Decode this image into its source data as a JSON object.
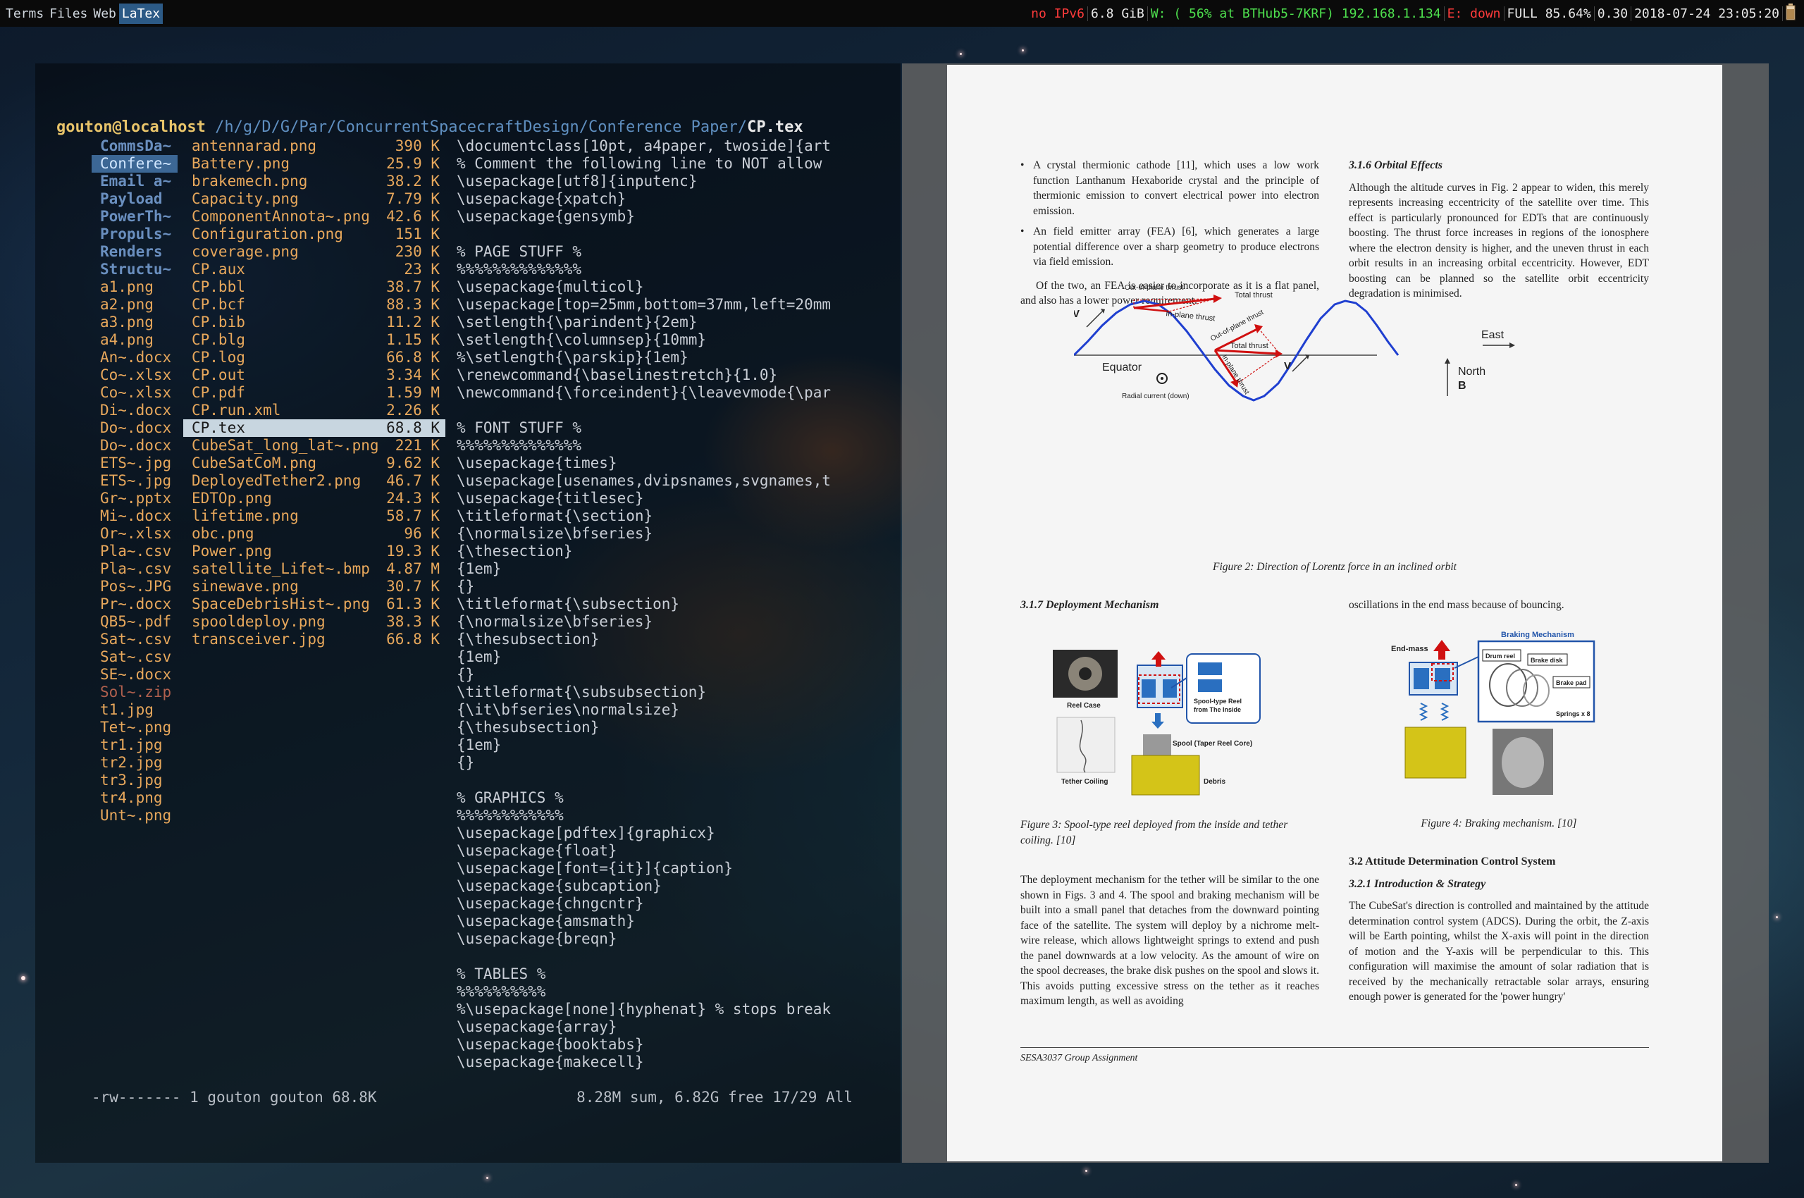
{
  "topbar": {
    "workspaces": [
      "Terms",
      "Files",
      "Web",
      "LaTex"
    ],
    "active_workspace": "LaTex",
    "status": {
      "ipv6": "no IPv6",
      "memory": "6.8 GiB",
      "wireless": "W: ( 56% at BTHub5-7KRF) 192.168.1.134",
      "ethernet": "E: down",
      "battery": "FULL 85.64%",
      "load": "0.30",
      "datetime": "2018-07-24 23:05:20"
    }
  },
  "terminal": {
    "prompt_user": "gouton@localhost",
    "prompt_path": " /h/g/D/G/Par/ConcurrentSpacecraftDesign/Conference Paper/",
    "prompt_file": "CP.tex",
    "parent_entries": [
      "CommsDa~",
      "Confere~",
      "Email a~",
      "Payload",
      "PowerTh~",
      "Propuls~",
      "Renders",
      "Structu~",
      "a1.png",
      "a2.png",
      "a3.png",
      "a4.png",
      "An~.docx",
      "Co~.xlsx",
      "Co~.xlsx",
      "Di~.docx",
      "Do~.docx",
      "Do~.docx",
      "ETS~.jpg",
      "ETS~.jpg",
      "Gr~.pptx",
      "Mi~.docx",
      "Or~.xlsx",
      "Pla~.csv",
      "Pla~.csv",
      "Pos~.JPG",
      "Pr~.docx",
      "QB5~.pdf",
      "Sat~.csv",
      "Sat~.csv",
      "SE~.docx",
      "Sol~.zip",
      "t1.jpg",
      "Tet~.png",
      "tr1.jpg",
      "tr2.jpg",
      "tr3.jpg",
      "tr4.png",
      "Unt~.png"
    ],
    "files": [
      {
        "name": "antennarad.png",
        "size": "390 K"
      },
      {
        "name": "Battery.png",
        "size": "25.9 K"
      },
      {
        "name": "brakemech.png",
        "size": "38.2 K"
      },
      {
        "name": "Capacity.png",
        "size": "7.79 K"
      },
      {
        "name": "ComponentAnnota~.png",
        "size": "42.6 K"
      },
      {
        "name": "Configuration.png",
        "size": "151 K"
      },
      {
        "name": "coverage.png",
        "size": "230 K"
      },
      {
        "name": "CP.aux",
        "size": "23 K"
      },
      {
        "name": "CP.bbl",
        "size": "38.7 K"
      },
      {
        "name": "CP.bcf",
        "size": "88.3 K"
      },
      {
        "name": "CP.bib",
        "size": "11.2 K"
      },
      {
        "name": "CP.blg",
        "size": "1.15 K"
      },
      {
        "name": "CP.log",
        "size": "66.8 K"
      },
      {
        "name": "CP.out",
        "size": "3.34 K"
      },
      {
        "name": "CP.pdf",
        "size": "1.59 M"
      },
      {
        "name": "CP.run.xml",
        "size": "2.26 K"
      },
      {
        "name": "CP.tex",
        "size": "68.8 K"
      },
      {
        "name": "CubeSat_long_lat~.png",
        "size": "221 K"
      },
      {
        "name": "CubeSatCoM.png",
        "size": "9.62 K"
      },
      {
        "name": "DeployedTether2.png",
        "size": "46.7 K"
      },
      {
        "name": "EDTOp.png",
        "size": "24.3 K"
      },
      {
        "name": "lifetime.png",
        "size": "58.7 K"
      },
      {
        "name": "obc.png",
        "size": "96 K"
      },
      {
        "name": "Power.png",
        "size": "19.3 K"
      },
      {
        "name": "satellite_Lifet~.bmp",
        "size": "4.87 M"
      },
      {
        "name": "sinewave.png",
        "size": "30.7 K"
      },
      {
        "name": "SpaceDebrisHist~.png",
        "size": "61.3 K"
      },
      {
        "name": "spooldeploy.png",
        "size": "38.3 K"
      },
      {
        "name": "transceiver.jpg",
        "size": "66.8 K"
      }
    ],
    "preview": [
      "\\documentclass[10pt, a4paper, twoside]{art",
      "% Comment the following line to NOT allow",
      "\\usepackage[utf8]{inputenc}",
      "\\usepackage{xpatch}",
      "\\usepackage{gensymb}",
      "",
      "% PAGE STUFF %",
      "%%%%%%%%%%%%%%",
      "\\usepackage{multicol}",
      "\\usepackage[top=25mm,bottom=37mm,left=20mm",
      "\\setlength{\\parindent}{2em}",
      "\\setlength{\\columnsep}{10mm}",
      "%\\setlength{\\parskip}{1em}",
      "\\renewcommand{\\baselinestretch}{1.0}",
      "\\newcommand{\\forceindent}{\\leavevmode{\\par",
      "",
      "% FONT STUFF %",
      "%%%%%%%%%%%%%%",
      "\\usepackage{times}",
      "\\usepackage[usenames,dvipsnames,svgnames,t",
      "\\usepackage{titlesec}",
      "\\titleformat{\\section}",
      "{\\normalsize\\bfseries}",
      "{\\thesection}",
      "{1em}",
      "{}",
      "\\titleformat{\\subsection}",
      "{\\normalsize\\bfseries}",
      "{\\thesubsection}",
      "{1em}",
      "{}",
      "\\titleformat{\\subsubsection}",
      "{\\it\\bfseries\\normalsize}",
      "{\\thesubsection}",
      "{1em}",
      "{}",
      "",
      "% GRAPHICS %",
      "%%%%%%%%%%%%",
      "\\usepackage[pdftex]{graphicx}",
      "\\usepackage{float}",
      "\\usepackage[font={it}]{caption}",
      "\\usepackage{subcaption}",
      "\\usepackage{chngcntr}",
      "\\usepackage{amsmath}",
      "\\usepackage{breqn}",
      "",
      "% TABLES %",
      "%%%%%%%%%%",
      "%\\usepackage[none]{hyphenat} % stops break",
      "\\usepackage{array}",
      "\\usepackage{booktabs}",
      "\\usepackage{makecell}"
    ],
    "statusline": {
      "left": "-rw------- 1 gouton gouton 68.8K",
      "right": "8.28M sum, 6.82G free  17/29  All"
    }
  },
  "pdf": {
    "bullet1": "A crystal thermionic cathode [11], which uses a low work function Lanthanum Hexaboride crystal and the principle of thermionic emission to convert electrical power into electron emission.",
    "bullet2": "An field emitter array (FEA) [6], which generates a large potential difference over a sharp geometry to produce electrons via field emission.",
    "para_fea": "Of the two, an FEA is easier to incorporate as it is a flat panel, and also has a lower power requirement.",
    "h316": "3.1.6    Orbital Effects",
    "para_orbital": "Although the altitude curves in Fig. 2 appear to widen, this merely represents increasing eccentricity of the satellite over time. This effect is particularly pronounced for EDTs that are continuously boosting. The thrust force increases in regions of the ionosphere where the electron density is higher, and the uneven thrust in each orbit results in an increasing orbital eccentricity. However, EDT boosting can be planned so the satellite orbit eccentricity degradation is minimised.",
    "fig2": {
      "out_of_plane": "Out-of-plane thrust",
      "total_thrust": "Total thrust",
      "in_plane": "In-plane thrust",
      "v": "V",
      "equator": "Equator",
      "east": "East",
      "north": "North",
      "b": "B",
      "radial": "Radial current (down)",
      "caption": "Figure 2: Direction of Lorentz force in an inclined orbit"
    },
    "h317": "3.1.7    Deployment Mechanism",
    "oscillations": "oscillations in the end mass because of bouncing.",
    "fig3": {
      "reel_case": "Reel Case",
      "tether_coiling": "Tether Coiling",
      "spool_inside": "Spool-type Reel from The Inside",
      "spool_taper": "Spool (Taper Reel Core)",
      "debris": "Debris",
      "caption": "Figure 3: Spool-type reel deployed from the inside and tether coiling. [10]"
    },
    "fig4": {
      "braking": "Braking Mechanism",
      "end_mass": "End-mass",
      "drum_reel": "Drum reel",
      "brake_disk": "Brake disk",
      "brake_pad": "Brake pad",
      "springs": "Springs x 8",
      "caption": "Figure 4: Braking mechanism. [10]"
    },
    "para_deploy": "The deployment mechanism for the tether will be similar to the one shown in Figs. 3 and 4. The spool and braking mechanism will be built into a small panel that detaches from the downward pointing face of the satellite. The system will deploy by a nichrome melt-wire release, which allows lightweight springs to extend and push the panel downwards at a low velocity. As the amount of wire on the spool decreases, the brake disk pushes on the spool and slows it. This avoids putting excessive stress on the tether as it reaches maximum length, as well as avoiding",
    "h32": "3.2    Attitude Determination Control System",
    "h321": "3.2.1    Introduction & Strategy",
    "para_adcs": "The CubeSat's direction is controlled and maintained by the attitude determination control system (ADCS). During the orbit, the Z-axis will be Earth pointing, whilst the X-axis will point in the direction of motion and the Y-axis will be perpendicular to this. This configuration will maximise the amount of solar radiation that is received by the mechanically retractable solar arrays, ensuring enough power is generated for the 'power hungry'",
    "footer": "SESA3037 Group Assignment"
  }
}
